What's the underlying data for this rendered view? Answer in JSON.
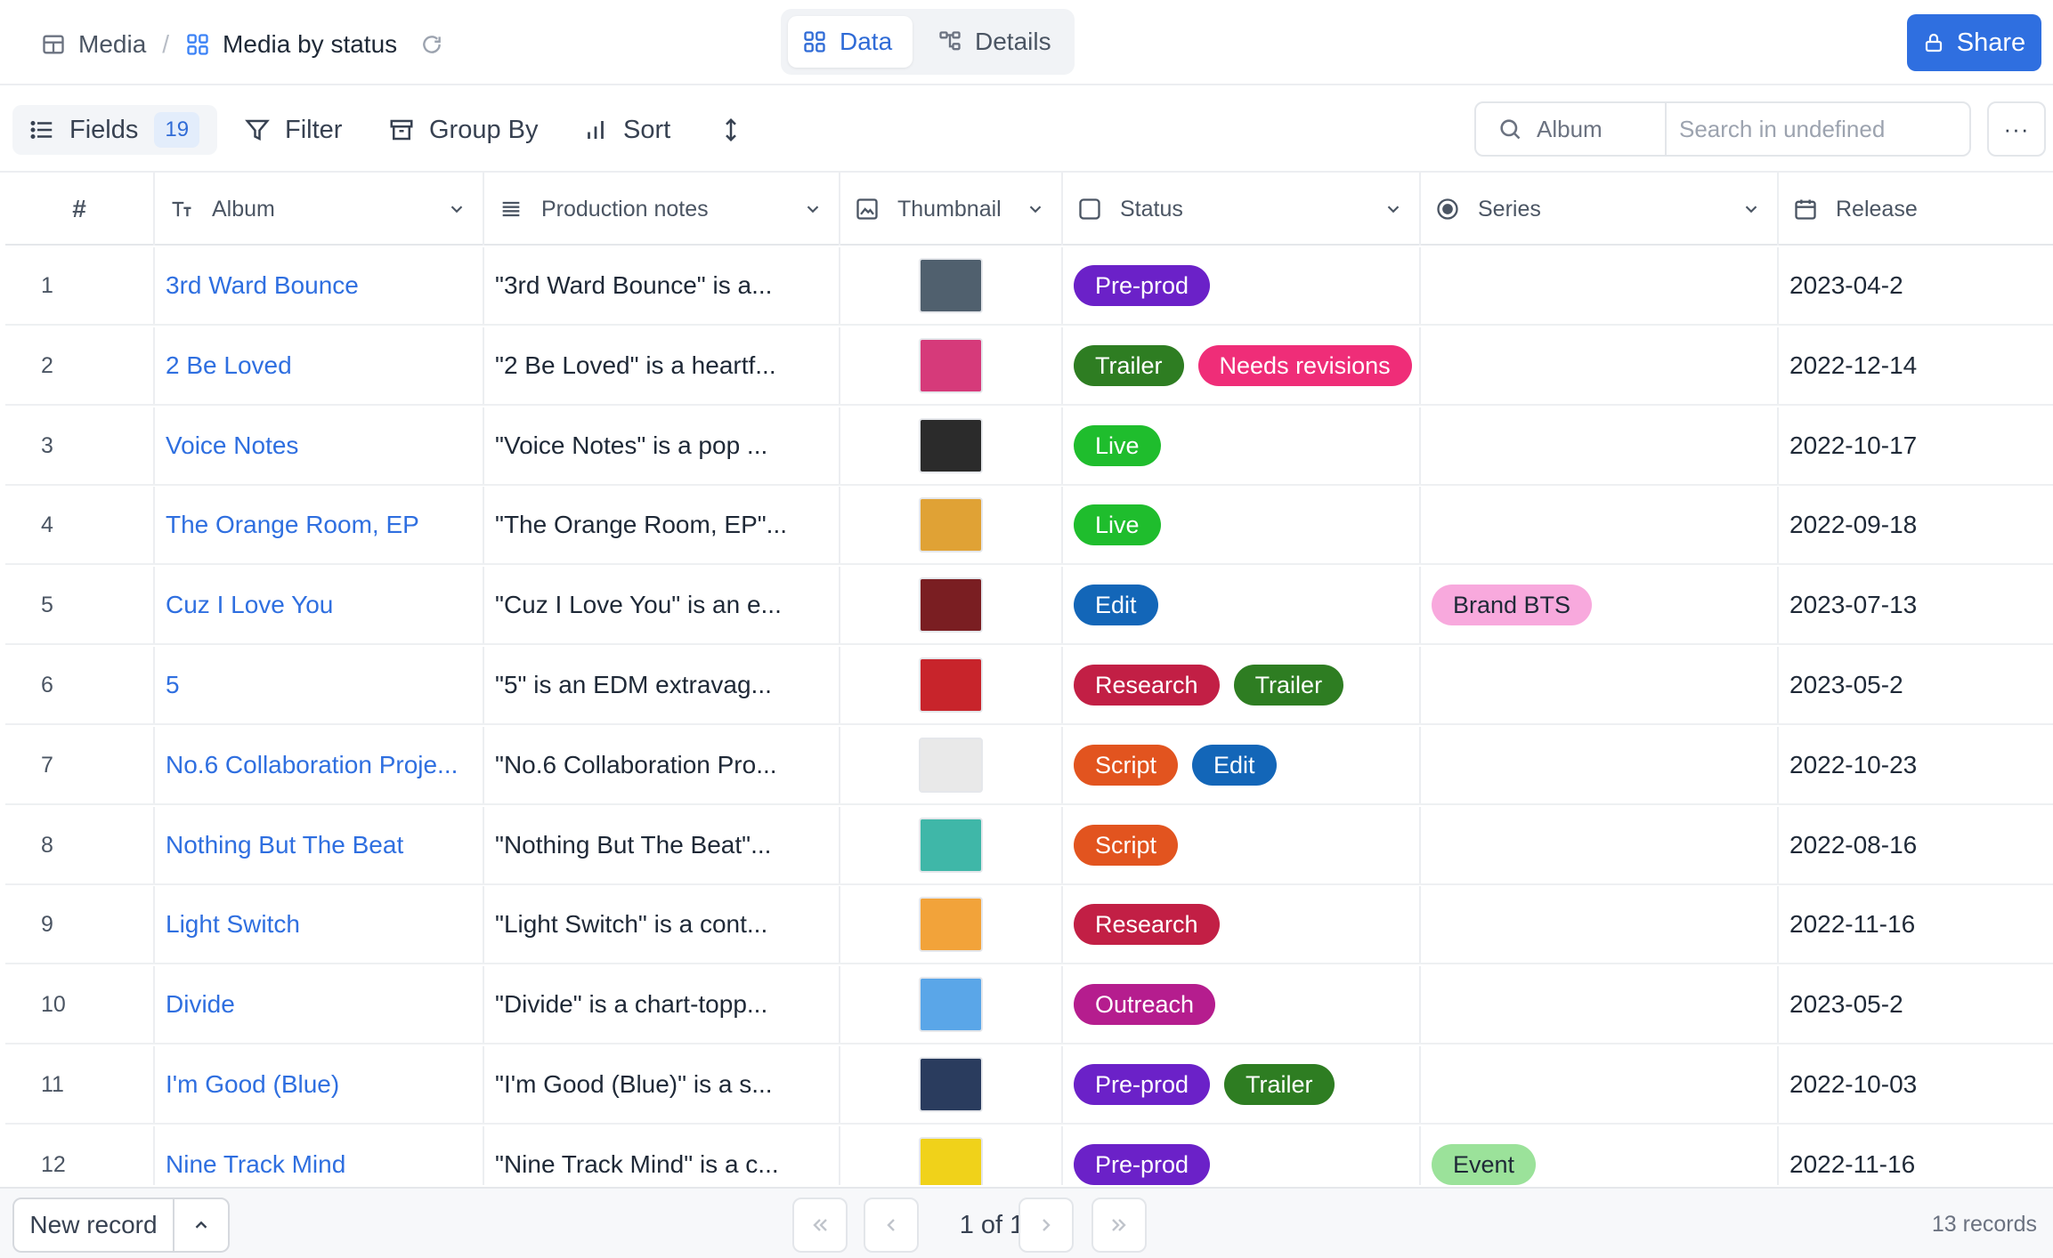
{
  "breadcrumb": {
    "table": "Media",
    "separator": "/",
    "view": "Media by status"
  },
  "view_switch": {
    "data_label": "Data",
    "details_label": "Details"
  },
  "share_label": "Share",
  "toolbar": {
    "fields_label": "Fields",
    "fields_count": "19",
    "filter_label": "Filter",
    "group_label": "Group By",
    "sort_label": "Sort"
  },
  "search": {
    "field": "Album",
    "placeholder": "Search in undefined"
  },
  "more_label": "···",
  "columns": {
    "num": "#",
    "album": "Album",
    "notes": "Production notes",
    "thumbnail": "Thumbnail",
    "status": "Status",
    "series": "Series",
    "release": "Release"
  },
  "tag_colors": {
    "Pre-prod": "#6b21c8",
    "Trailer": "#2e7d22",
    "Needs revisions": "#ef2d78",
    "Live": "#1fbd2d",
    "Edit": "#1366b8",
    "Research": "#c21f45",
    "Script": "#e2541f",
    "Outreach": "#b51d8e",
    "Brand BTS": "#f8a9dd",
    "Event": "#9be29a"
  },
  "rows": [
    {
      "num": "1",
      "album": "3rd Ward Bounce",
      "notes": "\"3rd Ward Bounce\" is a...",
      "thumb_color": "#50606e",
      "status": [
        "Pre-prod"
      ],
      "series": [],
      "release": "2023-04-2"
    },
    {
      "num": "2",
      "album": "2 Be Loved",
      "notes": "\"2 Be Loved\" is a heartf...",
      "thumb_color": "#d63a7a",
      "status": [
        "Trailer",
        "Needs revisions"
      ],
      "series": [],
      "release": "2022-12-14"
    },
    {
      "num": "3",
      "album": "Voice Notes",
      "notes": "\"Voice Notes\" is a pop ...",
      "thumb_color": "#2b2b2b",
      "status": [
        "Live"
      ],
      "series": [],
      "release": "2022-10-17"
    },
    {
      "num": "4",
      "album": "The Orange Room, EP",
      "notes": "\"The Orange Room, EP\"...",
      "thumb_color": "#e0a235",
      "status": [
        "Live"
      ],
      "series": [],
      "release": "2022-09-18"
    },
    {
      "num": "5",
      "album": "Cuz I Love You",
      "notes": "\"Cuz I Love You\" is an e...",
      "thumb_color": "#7a1e22",
      "status": [
        "Edit"
      ],
      "series": [
        "Brand BTS"
      ],
      "release": "2023-07-13"
    },
    {
      "num": "6",
      "album": "5",
      "notes": "\"5\" is an EDM extravag...",
      "thumb_color": "#c8242b",
      "status": [
        "Research",
        "Trailer"
      ],
      "series": [],
      "release": "2023-05-2"
    },
    {
      "num": "7",
      "album": "No.6 Collaboration Proje...",
      "notes": "\"No.6 Collaboration Pro...",
      "thumb_color": "#e9e9e9",
      "status": [
        "Script",
        "Edit"
      ],
      "series": [],
      "release": "2022-10-23"
    },
    {
      "num": "8",
      "album": "Nothing But The Beat",
      "notes": "\"Nothing But The Beat\"...",
      "thumb_color": "#3fb7a8",
      "status": [
        "Script"
      ],
      "series": [],
      "release": "2022-08-16"
    },
    {
      "num": "9",
      "album": "Light Switch",
      "notes": "\"Light Switch\" is a cont...",
      "thumb_color": "#f2a33a",
      "status": [
        "Research"
      ],
      "series": [],
      "release": "2022-11-16"
    },
    {
      "num": "10",
      "album": "Divide",
      "notes": "\"Divide\" is a chart-topp...",
      "thumb_color": "#5aa6e8",
      "status": [
        "Outreach"
      ],
      "series": [],
      "release": "2023-05-2"
    },
    {
      "num": "11",
      "album": "I'm Good (Blue)",
      "notes": "\"I'm Good (Blue)\" is a s...",
      "thumb_color": "#2a3c5e",
      "status": [
        "Pre-prod",
        "Trailer"
      ],
      "series": [],
      "release": "2022-10-03"
    },
    {
      "num": "12",
      "album": "Nine Track Mind",
      "notes": "\"Nine Track Mind\" is a c...",
      "thumb_color": "#f0d21a",
      "status": [
        "Pre-prod"
      ],
      "series": [
        "Event"
      ],
      "release": "2022-11-16"
    }
  ],
  "footer": {
    "new_record": "New record",
    "page_info": "1 of 1",
    "record_count": "13 records"
  }
}
